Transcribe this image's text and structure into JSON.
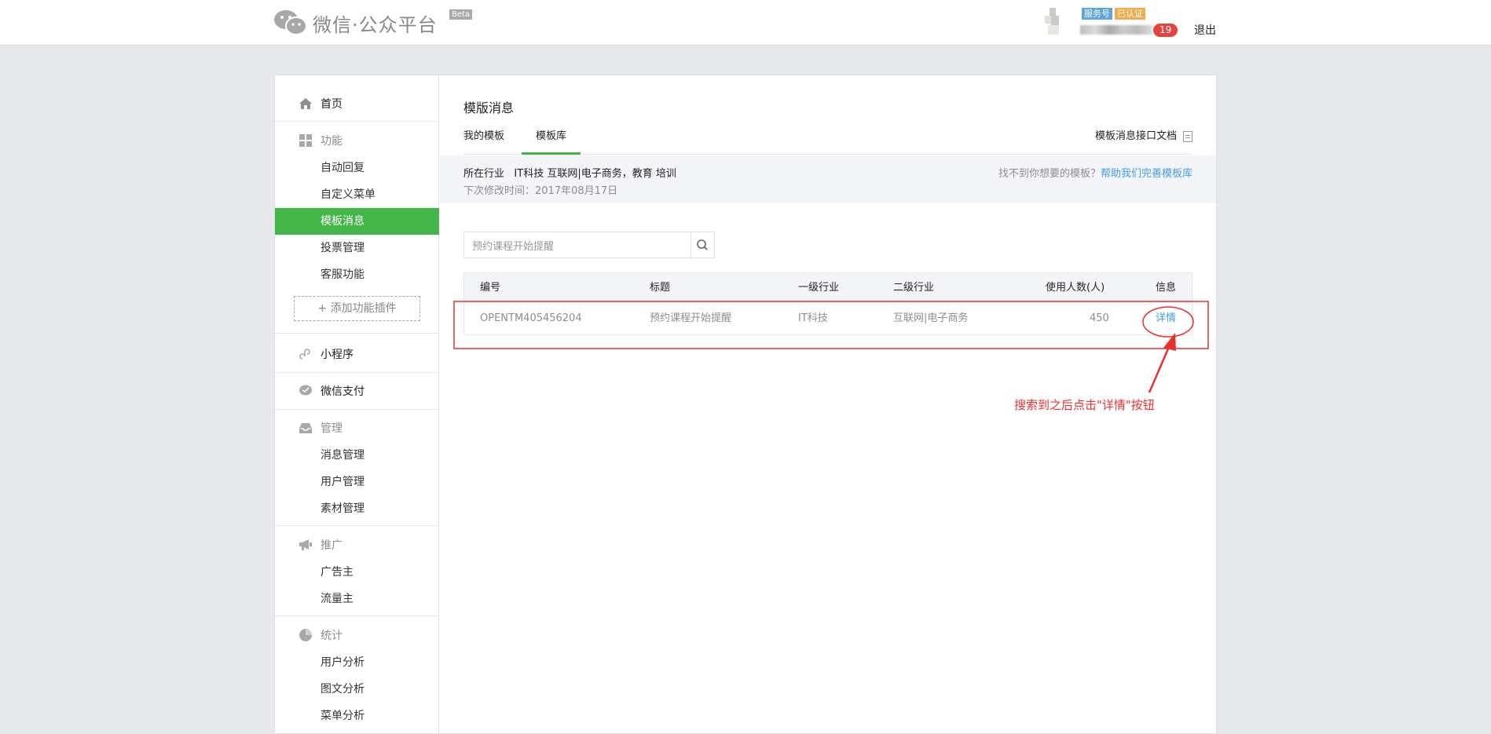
{
  "header": {
    "logo_text": "微信·公众平台",
    "beta_label": "Beta",
    "badge_service": "服务号",
    "badge_verified": "已认证",
    "notification_count": "19",
    "logout_label": "退出"
  },
  "sidebar": {
    "home": "首页",
    "sections": [
      {
        "title": "功能",
        "items": [
          "自动回复",
          "自定义菜单",
          "模板消息",
          "投票管理",
          "客服功能"
        ]
      },
      {
        "title": "小程序"
      },
      {
        "title": "微信支付"
      },
      {
        "title": "管理",
        "items": [
          "消息管理",
          "用户管理",
          "素材管理"
        ]
      },
      {
        "title": "推广",
        "items": [
          "广告主",
          "流量主"
        ]
      },
      {
        "title": "统计",
        "items": [
          "用户分析",
          "图文分析",
          "菜单分析"
        ]
      }
    ],
    "active_item": "模板消息",
    "add_plugin_label": "添加功能插件"
  },
  "main": {
    "page_title": "模版消息",
    "tabs": [
      "我的模板",
      "模板库"
    ],
    "active_tab": "模板库",
    "doc_link": "模板消息接口文档",
    "industry_label": "所在行业",
    "industry_value": "IT科技 互联网|电子商务，教育 培训",
    "next_modify": "下次修改时间：2017年08月17日",
    "help_text": "找不到你想要的模板？",
    "help_link": "帮助我们完善模板库",
    "search_placeholder": "预约课程开始提醒",
    "table": {
      "headers": [
        "编号",
        "标题",
        "一级行业",
        "二级行业",
        "使用人数(人)",
        "信息"
      ],
      "rows": [
        [
          "OPENTM405456204",
          "预约课程开始提醒",
          "IT科技",
          "互联网|电子商务",
          "450",
          "详情"
        ]
      ]
    }
  },
  "annotation": {
    "text": "搜索到之后点击\"详情\"按钮",
    "color": "#e8312f"
  },
  "colors": {
    "accent_green": "#44b549",
    "link_blue": "#459ae9",
    "annotation_red": "#e8312f"
  }
}
